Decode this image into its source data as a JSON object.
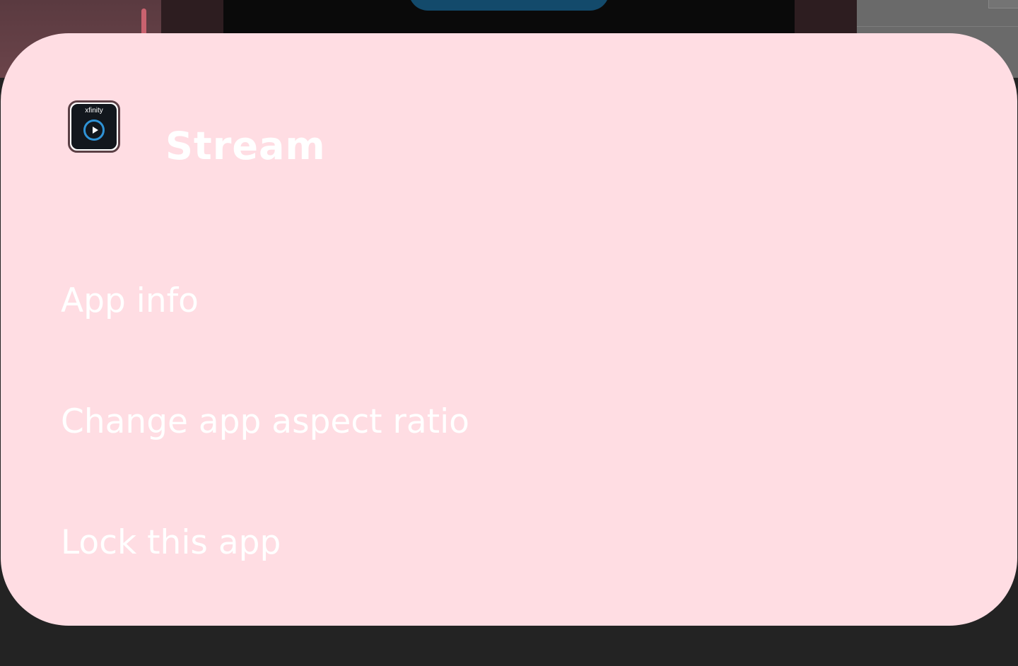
{
  "popup": {
    "app_name": "Stream",
    "app_icon": {
      "name": "xfinity-stream-icon",
      "brand_text": "xfinity"
    },
    "menu_items": [
      {
        "label": "App info"
      },
      {
        "label": "Change app aspect ratio"
      },
      {
        "label": "Lock this app"
      }
    ]
  },
  "colors": {
    "sheet_background": "#ffdde3",
    "text": "#ffffff",
    "scrim": "#232323",
    "icon_accent": "#2f93d6"
  }
}
